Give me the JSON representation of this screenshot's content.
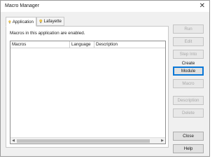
{
  "window": {
    "title": "Macro Manager",
    "close_glyph": "✕"
  },
  "tabs": [
    {
      "label": "Application",
      "icon": "lightbulb-icon",
      "active": true
    },
    {
      "label": "Lafayette",
      "icon": "lightbulb-icon",
      "active": false
    }
  ],
  "panel": {
    "caption": "Macros in this application are enabled."
  },
  "table": {
    "columns": [
      "Macros",
      "Language",
      "Description"
    ],
    "rows": []
  },
  "scrollbar": {
    "left_glyph": "◀",
    "right_glyph": "▶"
  },
  "buttons": {
    "run": "Run",
    "edit": "Edit",
    "step_into": "Step Into",
    "create_label": "Create",
    "module": "Module",
    "macro": "Macro",
    "description": "Description",
    "delete": "Delete",
    "close": "Close",
    "help": "Help"
  },
  "colors": {
    "focus_border": "#0a78d7",
    "bulb": "#f2c94c"
  }
}
